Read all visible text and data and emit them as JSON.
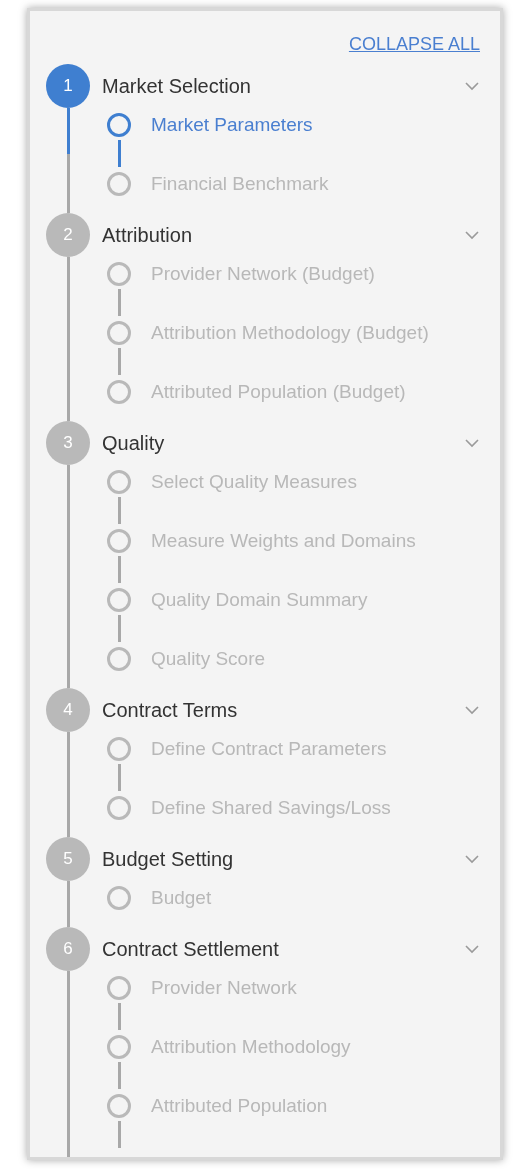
{
  "collapse_all": "COLLAPSE ALL",
  "steps": [
    {
      "number": "1",
      "title": "Market Selection",
      "active": true,
      "expanded": true,
      "substeps": [
        {
          "label": "Market Parameters",
          "selected": true
        },
        {
          "label": "Financial Benchmark",
          "selected": false
        }
      ]
    },
    {
      "number": "2",
      "title": "Attribution",
      "active": false,
      "expanded": true,
      "substeps": [
        {
          "label": "Provider Network (Budget)",
          "selected": false
        },
        {
          "label": "Attribution Methodology (Budget)",
          "selected": false
        },
        {
          "label": "Attributed Population (Budget)",
          "selected": false
        }
      ]
    },
    {
      "number": "3",
      "title": "Quality",
      "active": false,
      "expanded": true,
      "substeps": [
        {
          "label": "Select Quality Measures",
          "selected": false
        },
        {
          "label": "Measure Weights and Domains",
          "selected": false
        },
        {
          "label": "Quality Domain Summary",
          "selected": false
        },
        {
          "label": "Quality Score",
          "selected": false
        }
      ]
    },
    {
      "number": "4",
      "title": "Contract Terms",
      "active": false,
      "expanded": true,
      "substeps": [
        {
          "label": "Define Contract Parameters",
          "selected": false
        },
        {
          "label": "Define Shared Savings/Loss",
          "selected": false
        }
      ]
    },
    {
      "number": "5",
      "title": "Budget Setting",
      "active": false,
      "expanded": true,
      "substeps": [
        {
          "label": "Budget",
          "selected": false
        }
      ]
    },
    {
      "number": "6",
      "title": "Contract Settlement",
      "active": false,
      "expanded": true,
      "substeps": [
        {
          "label": "Provider Network",
          "selected": false
        },
        {
          "label": "Attribution Methodology",
          "selected": false
        },
        {
          "label": "Attributed Population",
          "selected": false
        }
      ]
    }
  ]
}
